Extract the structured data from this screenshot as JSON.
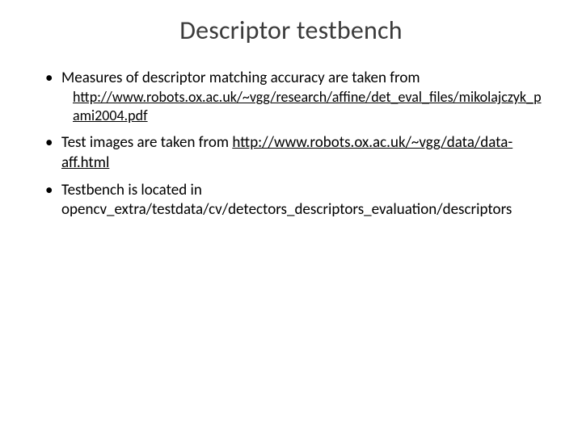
{
  "title": "Descriptor testbench",
  "bullets": [
    {
      "text": "Measures of descriptor matching accuracy are taken from",
      "link": "http://www.robots.ox.ac.uk/~vgg/research/affine/det_eval_files/mikolajczyk_pami2004.pdf"
    },
    {
      "text": "Test images are taken from ",
      "link_inline": "http://www.robots.ox.ac.uk/~vgg/data/data-aff.html"
    },
    {
      "text": "Testbench is located in opencv_extra/testdata/cv/detectors_descriptors_evaluation/descriptors"
    }
  ]
}
